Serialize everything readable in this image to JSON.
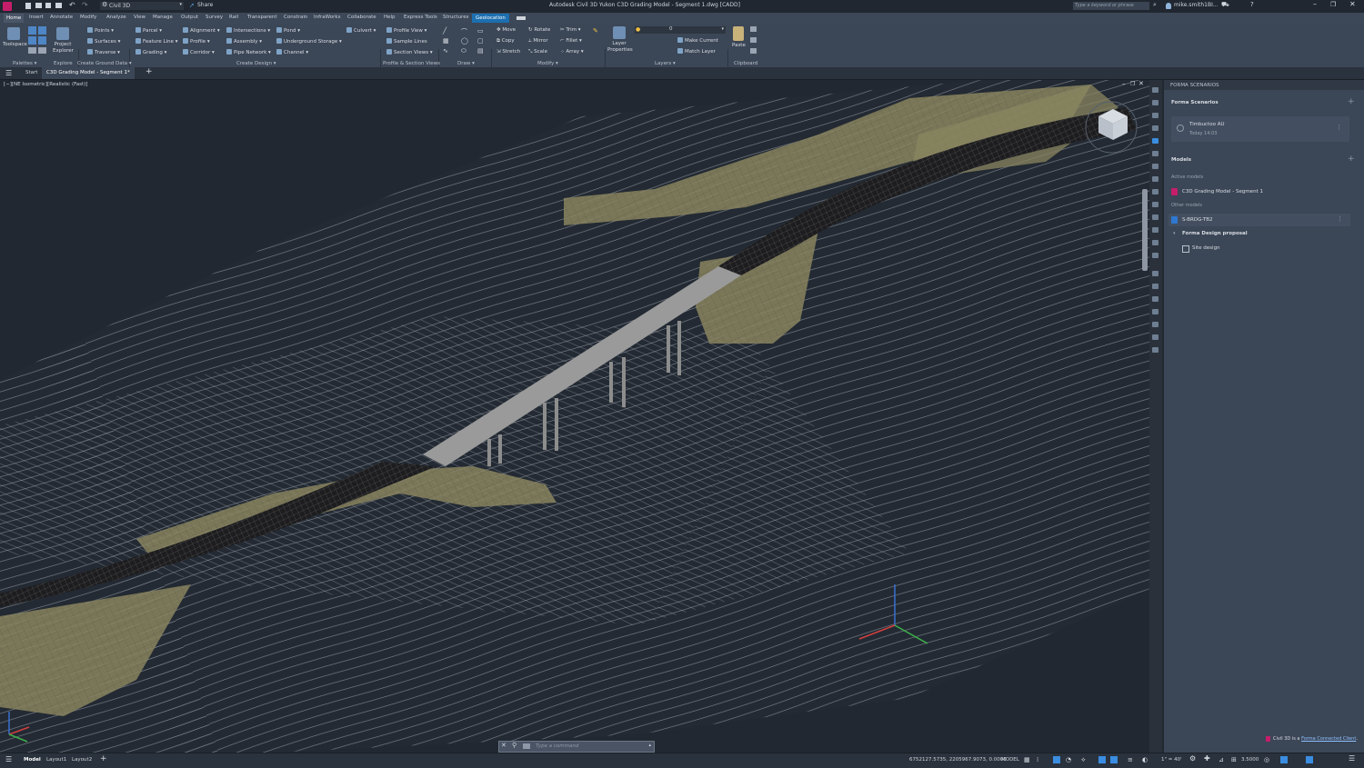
{
  "titlebar": {
    "workspace": "Civil 3D",
    "share": "Share",
    "title": "Autodesk Civil 3D Yukon   C3D Grading Model - Segment 1.dwg [CADD]",
    "search_placeholder": "Type a keyword or phrase",
    "user": "mike.smith1BI..."
  },
  "ribbon_tabs": [
    "Home",
    "Insert",
    "Annotate",
    "Modify",
    "Analyze",
    "View",
    "Manage",
    "Output",
    "Survey",
    "Rail",
    "Transparent",
    "Constrain",
    "InfraWorks",
    "Collaborate",
    "Help",
    "Express Tools",
    "Structures",
    "Geolocation"
  ],
  "ribbon": {
    "toolspace": "Toolspace",
    "project_explorer": "Project Explorer",
    "points": "Points",
    "surfaces": "Surfaces",
    "traverse": "Traverse",
    "parcel": "Parcel",
    "feature_line": "Feature Line",
    "grading": "Grading",
    "alignment": "Alignment",
    "profile": "Profile",
    "corridor": "Corridor",
    "intersections": "Intersections",
    "assembly": "Assembly",
    "pipe_network": "Pipe Network",
    "pond": "Pond",
    "underground_storage": "Underground Storage",
    "channel": "Channel",
    "culvert": "Culvert",
    "profile_view": "Profile View",
    "sample_lines": "Sample Lines",
    "section_views": "Section Views",
    "move": "Move",
    "copy": "Copy",
    "stretch": "Stretch",
    "rotate": "Rotate",
    "mirror": "Mirror",
    "scale": "Scale",
    "trim": "Trim",
    "fillet": "Fillet",
    "array": "Array",
    "layer_properties": "Layer Properties",
    "layer_value": "0",
    "make_current": "Make Current",
    "match_layer": "Match Layer",
    "paste": "Paste",
    "panels": [
      "Palettes",
      "Explore",
      "Create Ground Data",
      "Create Design",
      "Profile & Section Views",
      "Draw",
      "Modify",
      "Layers",
      "Clipboard"
    ]
  },
  "doc_tabs": {
    "start": "Start",
    "active": "C3D Grading Model - Segment 1*"
  },
  "viewport": {
    "label": "[−][NE Isometric][Realistic (Fast)]"
  },
  "forma": {
    "panel_header": "FORMA SCENARIOS",
    "title": "Forma Scenarios",
    "scenario_name": "Timbuctoo AU",
    "scenario_time": "Today 14:03",
    "models_heading": "Models",
    "active_models_label": "Active models",
    "active_model": "C3D Grading Model - Segment 1",
    "other_models_label": "Other models",
    "other_model": "S-BRDG-TB2",
    "proposal": "Forma Design proposal",
    "site_design": "Site design",
    "footer_prefix": "Civil 3D is a ",
    "footer_link": "Forma Connected Client",
    "footer_suffix": "."
  },
  "status": {
    "tabs": [
      "Model",
      "Layout1",
      "Layout2"
    ],
    "coords": "6752127.5735, 2205967.9073, 0.0000",
    "space": "MODEL",
    "scale": "1\" = 40'",
    "value": "3.5000"
  },
  "command": {
    "placeholder": "Type a command"
  },
  "colors": {
    "accent": "#1c6fb0",
    "background": "#212830",
    "terrain_fill": "#8a8560",
    "bridge": "#9a9a9a"
  }
}
